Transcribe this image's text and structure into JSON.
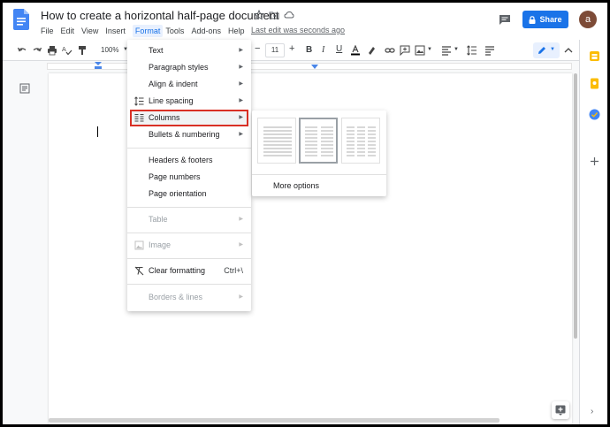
{
  "header": {
    "title": "How to create a horizontal half-page document",
    "menus": [
      "File",
      "Edit",
      "View",
      "Insert",
      "Format",
      "Tools",
      "Add-ons",
      "Help"
    ],
    "active_menu_index": 4,
    "last_edit": "Last edit was seconds ago",
    "share_label": "Share",
    "avatar_initial": "a"
  },
  "toolbar": {
    "zoom": "100%",
    "font_size": "11"
  },
  "format_menu": {
    "items": [
      {
        "label": "Text",
        "submenu": true
      },
      {
        "label": "Paragraph styles",
        "submenu": true
      },
      {
        "label": "Align & indent",
        "submenu": true
      },
      {
        "label": "Line spacing",
        "submenu": true,
        "icon": "line-spacing-icon"
      },
      {
        "label": "Columns",
        "submenu": true,
        "icon": "columns-icon",
        "highlighted": true
      },
      {
        "label": "Bullets & numbering",
        "submenu": true
      },
      {
        "label": "Headers & footers"
      },
      {
        "label": "Page numbers"
      },
      {
        "label": "Page orientation"
      },
      {
        "label": "Table",
        "submenu": true,
        "disabled": true
      },
      {
        "label": "Image",
        "submenu": true,
        "disabled": true,
        "icon": "image-icon"
      },
      {
        "label": "Clear formatting",
        "shortcut": "Ctrl+\\",
        "icon": "clear-formatting-icon"
      },
      {
        "label": "Borders & lines",
        "submenu": true,
        "disabled": true
      }
    ]
  },
  "columns_submenu": {
    "presets": [
      "one-column",
      "two-columns",
      "three-columns"
    ],
    "selected_index": 1,
    "more_options": "More options"
  },
  "colors": {
    "accent": "#1a73e8",
    "highlight_border": "#d93025"
  }
}
